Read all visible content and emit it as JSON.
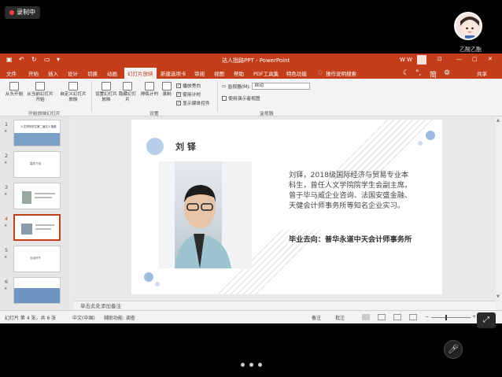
{
  "recording": {
    "label": "录制中"
  },
  "user": {
    "name": "乙酸乙酯"
  },
  "window": {
    "title": "达人指路PPT  -  PowerPoint",
    "user_initials": "W W"
  },
  "tabs": [
    {
      "label": "文件"
    },
    {
      "label": "开始"
    },
    {
      "label": "插入"
    },
    {
      "label": "设计"
    },
    {
      "label": "切换"
    },
    {
      "label": "动画"
    },
    {
      "label": "幻灯片放映",
      "active": true
    },
    {
      "label": "新建选项卡"
    },
    {
      "label": "审阅"
    },
    {
      "label": "视图"
    },
    {
      "label": "帮助"
    },
    {
      "label": "PDF工具集"
    },
    {
      "label": "特色功能"
    }
  ],
  "tell_me": "操作说明搜索",
  "share": "共享",
  "ribbon": {
    "from_start": "从头开始",
    "from_current": "从当前幻灯片开始",
    "custom_show": "自定义幻灯片放映",
    "group_start": "开始放映幻灯片",
    "setup_show": "设置幻灯片放映",
    "hide_slide": "隐藏幻灯片",
    "rehearse": "排练计时",
    "record": "录制",
    "play_narrations": "播放旁白",
    "use_timings": "使用计时",
    "show_media_controls": "显示媒体控件",
    "group_setup": "设置",
    "monitor_label": "监视器(M):",
    "monitor_value": "自动",
    "presenter_view": "使用演示者视图",
    "group_monitors": "监视器",
    "simplified": "简"
  },
  "slides": [
    {
      "num": "1",
      "title": "人文学院学生第二届达人指路"
    },
    {
      "num": "2",
      "title": "嘉宾介绍"
    },
    {
      "num": "3",
      "title": ""
    },
    {
      "num": "4",
      "active": true,
      "title": ""
    },
    {
      "num": "5",
      "title": "互动环节"
    },
    {
      "num": "6",
      "title": ""
    }
  ],
  "slide": {
    "name": "刘 铎",
    "bio": "刘铎，2018级国际经济与贸易专业本科生，曾任人文学院院学生会副主席。曾于毕马威企业咨询、法国安盛金融、天健会计师事务所等知名企业实习。",
    "destination": "毕业去向：普华永道中天会计师事务所"
  },
  "notes_placeholder": "单击此处添加备注",
  "status": {
    "slide_count": "幻灯片 第 4 张，共 6 张",
    "language": "中文(中国)",
    "accessibility": "辅助功能: 调查",
    "notes": "备注",
    "comments": "批注"
  },
  "colors": {
    "accent": "#c43e1c",
    "circle_blue": "#b8cde8"
  }
}
